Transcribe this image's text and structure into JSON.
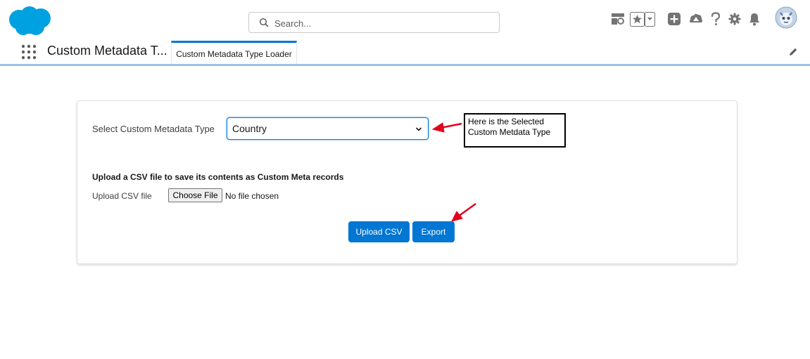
{
  "header": {
    "search_placeholder": "Search...",
    "icons": [
      "salesforce-cloud-logo",
      "search-icon",
      "guidance-center-icon",
      "favorites-star-icon",
      "favorites-dropdown-icon",
      "global-actions-plus-icon",
      "trailhead-icon",
      "help-question-icon",
      "setup-gear-icon",
      "notifications-bell-icon",
      "user-avatar"
    ]
  },
  "nav": {
    "app_name": "Custom Metadata T...",
    "tab_label": "Custom Metadata Type Loader"
  },
  "form": {
    "select_label": "Select Custom Metadata Type",
    "select_value": "Country",
    "upload_heading": "Upload a CSV file to save its contents as Custom Meta records",
    "upload_label": "Upload CSV file",
    "choose_file_label": "Choose File",
    "no_file_text": "No file chosen",
    "upload_button": "Upload CSV",
    "export_button": "Export"
  },
  "annotation": {
    "callout_text": "Here is the Selected Custom Metdata Type",
    "arrow_color": "#e3001b"
  },
  "colors": {
    "brand": "#0176d3",
    "logo": "#00a1e0"
  }
}
